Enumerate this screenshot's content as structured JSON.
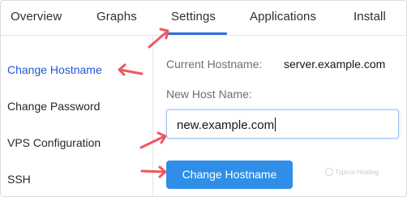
{
  "tabs": [
    {
      "label": "Overview"
    },
    {
      "label": "Graphs"
    },
    {
      "label": "Settings",
      "active": true
    },
    {
      "label": "Applications"
    },
    {
      "label": "Install"
    }
  ],
  "sidebar": {
    "items": [
      {
        "label": "Change Hostname",
        "active": true
      },
      {
        "label": "Change Password"
      },
      {
        "label": "VPS Configuration"
      },
      {
        "label": "SSH"
      }
    ]
  },
  "form": {
    "current_label": "Current Hostname:",
    "current_value": "server.example.com",
    "new_label": "New Host Name:",
    "new_value": "new.example.com",
    "submit_label": "Change Hostname"
  },
  "watermark": "Typical Hosting",
  "colors": {
    "accent": "#2f6fe0",
    "button": "#2f8fe8",
    "annotation_arrow": "#f0575f"
  }
}
